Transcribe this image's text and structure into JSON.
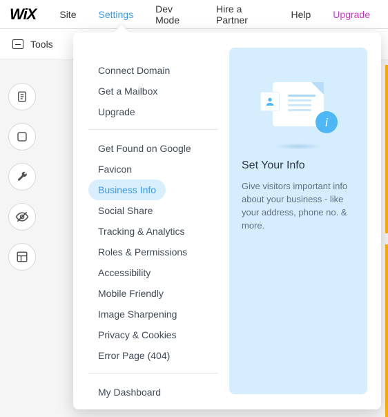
{
  "topbar": {
    "logo": "WiX",
    "items": [
      "Site",
      "Settings",
      "Dev Mode",
      "Hire a Partner",
      "Help"
    ],
    "upgrade": "Upgrade",
    "active_index": 1
  },
  "toolsbar": {
    "label": "Tools"
  },
  "leftrail": {
    "buttons": [
      "pages-icon",
      "add-section-icon",
      "settings-wrench-icon",
      "hide-icon",
      "layout-icon"
    ]
  },
  "settings_menu": {
    "group1": [
      "Connect Domain",
      "Get a Mailbox",
      "Upgrade"
    ],
    "group2": [
      "Get Found on Google",
      "Favicon",
      "Business Info",
      "Social Share",
      "Tracking & Analytics",
      "Roles & Permissions",
      "Accessibility",
      "Mobile Friendly",
      "Image Sharpening",
      "Privacy & Cookies",
      "Error Page (404)"
    ],
    "group3": [
      "My Dashboard"
    ],
    "selected": "Business Info"
  },
  "info_card": {
    "title": "Set Your Info",
    "description": "Give visitors important info about your business - like your address, phone no. & more."
  }
}
